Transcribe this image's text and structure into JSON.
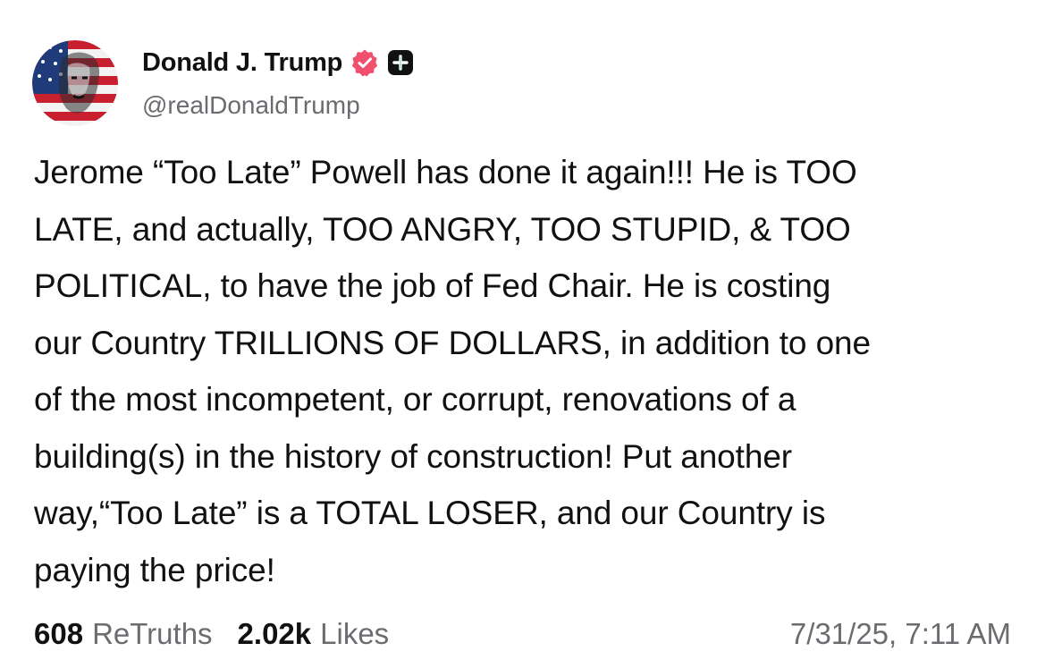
{
  "post": {
    "author": {
      "display_name": "Donald J. Trump",
      "handle": "@realDonaldTrump",
      "avatar_icon": "flag-portrait-avatar",
      "verified_icon": "verified-badge-icon",
      "verified_color": "#f0506e",
      "plus_icon": "plus-badge-icon"
    },
    "body_lines": [
      "Jerome “Too Late” Powell has done it again!!! He is TOO",
      "LATE, and actually, TOO ANGRY, TOO STUPID, & TOO",
      "POLITICAL, to have the job of Fed Chair. He is costing",
      "our Country TRILLIONS OF DOLLARS, in addition to one",
      "of the most incompetent, or corrupt, renovations of a",
      "building(s) in the history of construction! Put another",
      "way,“Too Late” is a TOTAL LOSER, and our Country is",
      "paying the price!"
    ],
    "stats": {
      "retruths_count": "608",
      "retruths_label": "ReTruths",
      "likes_count": "2.02k",
      "likes_label": "Likes"
    },
    "timestamp": "7/31/25, 7:11 AM"
  }
}
